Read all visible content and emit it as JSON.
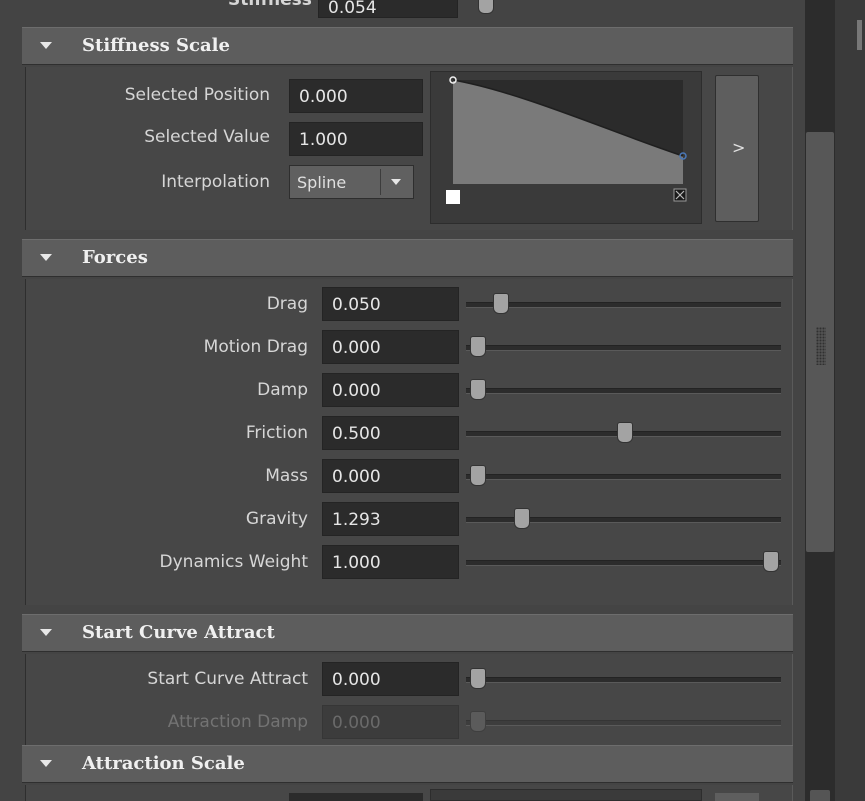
{
  "top_partial": {
    "label": "Stiffness",
    "value": "0.054"
  },
  "stiffness_scale": {
    "title": "Stiffness Scale",
    "selected_position_label": "Selected Position",
    "selected_position_value": "0.000",
    "selected_value_label": "Selected Value",
    "selected_value_value": "1.000",
    "interpolation_label": "Interpolation",
    "interpolation_value": "Spline",
    "expand_glyph": ">"
  },
  "forces": {
    "title": "Forces",
    "rows": [
      {
        "label": "Drag",
        "value": "0.050",
        "slider": 0.08
      },
      {
        "label": "Motion Drag",
        "value": "0.000",
        "slider": 0.0
      },
      {
        "label": "Damp",
        "value": "0.000",
        "slider": 0.0
      },
      {
        "label": "Friction",
        "value": "0.500",
        "slider": 0.5
      },
      {
        "label": "Mass",
        "value": "0.000",
        "slider": 0.0
      },
      {
        "label": "Gravity",
        "value": "1.293",
        "slider": 0.15
      },
      {
        "label": "Dynamics Weight",
        "value": "1.000",
        "slider": 1.0
      }
    ]
  },
  "start_curve_attract": {
    "title": "Start Curve Attract",
    "rows": [
      {
        "label": "Start Curve Attract",
        "value": "0.000",
        "slider": 0.0,
        "disabled": false
      },
      {
        "label": "Attraction Damp",
        "value": "0.000",
        "slider": 0.0,
        "disabled": true
      }
    ]
  },
  "attraction_scale": {
    "title": "Attraction Scale"
  },
  "colors": {
    "header": "#5d5d5d",
    "body": "#474747",
    "field": "#2b2b2b"
  }
}
